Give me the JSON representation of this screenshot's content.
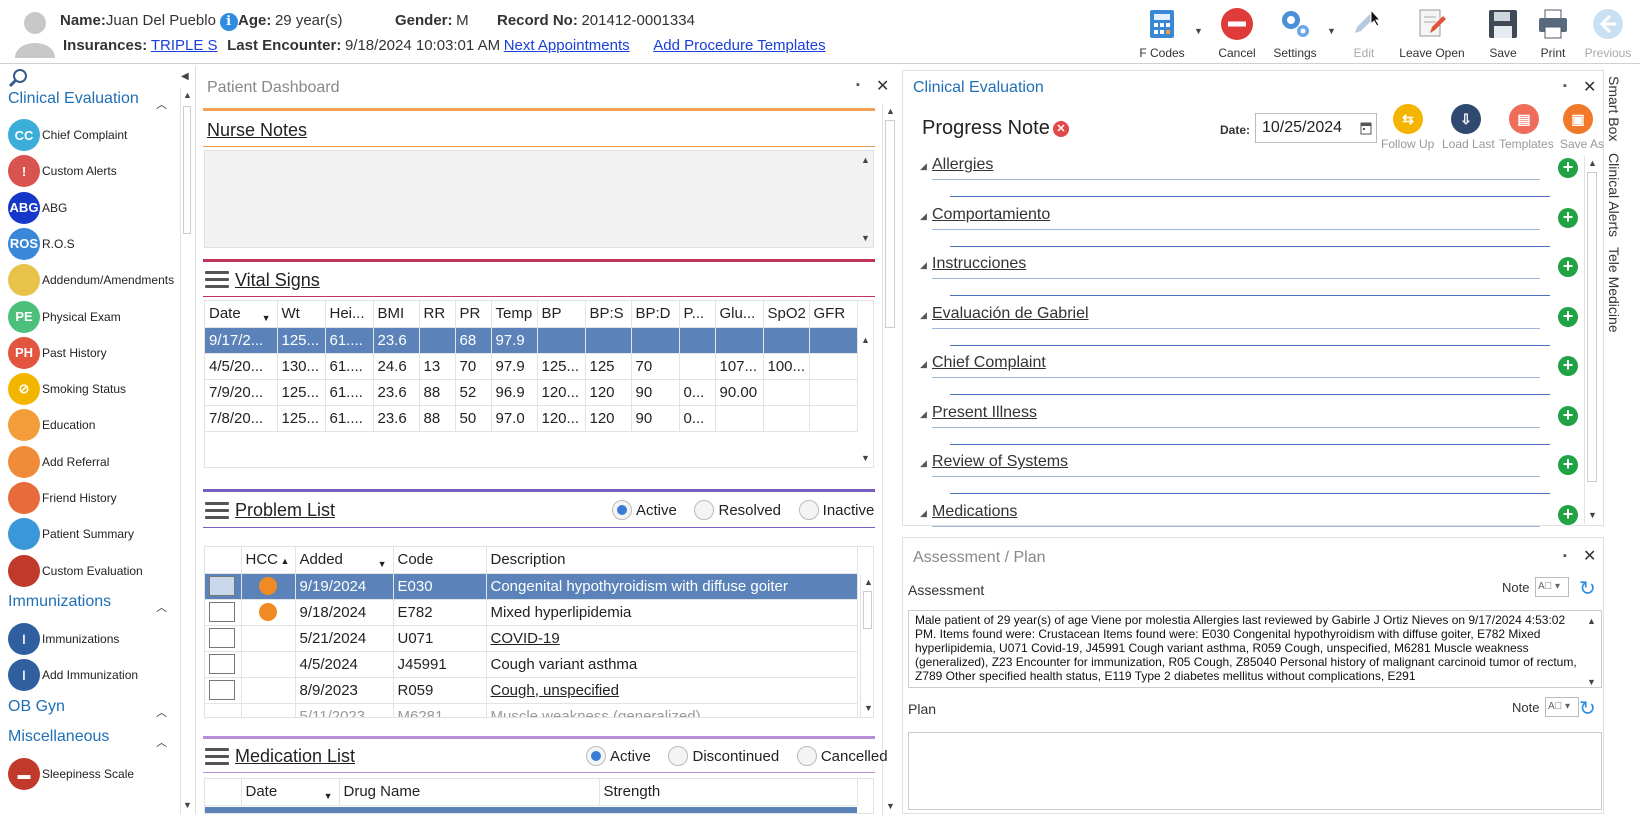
{
  "patient": {
    "name_label": "Name:",
    "name": "Juan Del Pueblo",
    "age_label": "Age:",
    "age": "29 year(s)",
    "gender_label": "Gender:",
    "gender": "M",
    "record_label": "Record No:",
    "record": "201412-0001334",
    "insurances_label": "Insurances:",
    "insurance": "TRIPLE S",
    "last_encounter_label": "Last Encounter:",
    "last_encounter": "9/18/2024 10:03:01 AM",
    "next_appointments": "Next Appointments",
    "add_procedure_templates": "Add Procedure Templates"
  },
  "toolbar": {
    "fcodes": "F Codes",
    "cancel": "Cancel",
    "settings": "Settings",
    "edit": "Edit",
    "leave_open": "Leave Open",
    "save": "Save",
    "print": "Print",
    "previous": "Previous"
  },
  "leftnav": {
    "sections": {
      "clinical": "Clinical Evaluation",
      "immunizations": "Immunizations",
      "obgyn": "OB Gyn",
      "misc": "Miscellaneous"
    },
    "clinical_items": [
      {
        "label": "Chief Complaint",
        "abbr": "CC",
        "color": "#3aaed8"
      },
      {
        "label": "Custom Alerts",
        "abbr": "!",
        "color": "#d9534f"
      },
      {
        "label": "ABG",
        "abbr": "ABG",
        "color": "#1737c9"
      },
      {
        "label": "R.O.S",
        "abbr": "ROS",
        "color": "#3a86d9"
      },
      {
        "label": "Addendum/Amendments",
        "abbr": "",
        "color": "#e9c24a"
      },
      {
        "label": "Physical Exam",
        "abbr": "PE",
        "color": "#4cc07a"
      },
      {
        "label": "Past History",
        "abbr": "PH",
        "color": "#e2553f"
      },
      {
        "label": "Smoking Status",
        "abbr": "⊘",
        "color": "#f2b600"
      },
      {
        "label": "Education",
        "abbr": "",
        "color": "#f39c3a"
      },
      {
        "label": "Add Referral",
        "abbr": "",
        "color": "#f08b3a"
      },
      {
        "label": "Friend History",
        "abbr": "",
        "color": "#e56b3a"
      },
      {
        "label": "Patient Summary",
        "abbr": "",
        "color": "#3a97d9"
      },
      {
        "label": "Custom Evaluation",
        "abbr": "",
        "color": "#c0392b"
      }
    ],
    "immunization_items": [
      {
        "label": "Immunizations",
        "color": "#2f5f9e"
      },
      {
        "label": "Add Immunization",
        "color": "#2f5f9e"
      }
    ],
    "misc_items": [
      {
        "label": "Sleepiness Scale",
        "color": "#c0392b"
      }
    ]
  },
  "dashboard": {
    "title": "Patient Dashboard",
    "nurse_notes": "Nurse Notes",
    "vital_signs": "Vital Signs",
    "vitals_headers": [
      "Date",
      "Wt",
      "Hei...",
      "BMI",
      "RR",
      "PR",
      "Temp",
      "BP",
      "BP:S",
      "BP:D",
      "P...",
      "Glu...",
      "SpO2",
      "GFR"
    ],
    "vitals_rows": [
      [
        "9/17/2...",
        "125...",
        "61....",
        "23.6",
        "",
        "68",
        "97.9",
        "",
        "",
        "",
        "",
        "",
        "",
        ""
      ],
      [
        "4/5/20...",
        "130...",
        "61....",
        "24.6",
        "13",
        "70",
        "97.9",
        "125...",
        "125",
        "70",
        "",
        "107...",
        "100...",
        ""
      ],
      [
        "7/9/20...",
        "125...",
        "61....",
        "23.6",
        "88",
        "52",
        "96.9",
        "120...",
        "120",
        "90",
        "0...",
        "90.00",
        "",
        ""
      ],
      [
        "7/8/20...",
        "125...",
        "61....",
        "23.6",
        "88",
        "50",
        "97.0",
        "120...",
        "120",
        "90",
        "0...",
        "",
        "",
        ""
      ]
    ],
    "problem_list": "Problem List",
    "problem_filters": [
      "Active",
      "Resolved",
      "Inactive"
    ],
    "problem_headers": [
      "",
      "HCC",
      "Added",
      "Code",
      "Description"
    ],
    "problem_rows": [
      {
        "hcc": true,
        "added": "9/19/2024",
        "code": "E030",
        "desc": "Congenital hypothyroidism with diffuse goiter",
        "link": false
      },
      {
        "hcc": true,
        "added": "9/18/2024",
        "code": "E782",
        "desc": "Mixed hyperlipidemia",
        "link": false
      },
      {
        "hcc": false,
        "added": "5/21/2024",
        "code": "U071",
        "desc": "COVID-19",
        "link": true
      },
      {
        "hcc": false,
        "added": "4/5/2024",
        "code": "J45991",
        "desc": "Cough variant asthma",
        "link": false
      },
      {
        "hcc": false,
        "added": "8/9/2023",
        "code": "R059",
        "desc": "Cough, unspecified",
        "link": true
      }
    ],
    "medication_list": "Medication List",
    "medication_filters": [
      "Active",
      "Discontinued",
      "Cancelled"
    ],
    "medication_headers": [
      "",
      "Date",
      "Drug Name",
      "Strength"
    ]
  },
  "clinical": {
    "title": "Clinical Evaluation",
    "progress_note": "Progress Note",
    "date_label": "Date:",
    "date_value": "10/25/2024",
    "actions": [
      "Follow Up",
      "Load Last",
      "Templates",
      "Save As"
    ],
    "sections": [
      "Allergies",
      "Comportamiento",
      "Instrucciones",
      "Evaluación de Gabriel",
      "Chief Complaint",
      "Present Illness",
      "Review of Systems",
      "Medications"
    ]
  },
  "side_tabs": [
    "Smart Box",
    "Clinical Alerts",
    "Tele Medicine"
  ],
  "assessment": {
    "title": "Assessment / Plan",
    "assessment_label": "Assessment",
    "note_label": "Note",
    "assessment_text": "Male patient of 29 year(s) of age Viene por molestia     Allergies last reviewed by Gabirle J Ortiz Nieves on 9/17/2024 4:53:02 PM.    Items found were:  Crustacean  Items found were:  E030 Congenital hypothyroidism with diffuse goiter, E782 Mixed hyperlipidemia, U071 Covid-19, J45991 Cough variant asthma, R059 Cough, unspecified, M6281 Muscle weakness (generalized), Z23 Encounter for immunization, R05 Cough, Z85040 Personal history of malignant carcinoid tumor of rectum, Z789 Other specified health status, E119 Type 2 diabetes mellitus without complications, E291",
    "plan_label": "Plan"
  },
  "colors": {
    "accent": "#1f6fb6",
    "selected_row": "#5b83b9",
    "nurse_bar": "#f0a050",
    "vitals_bar": "#c0345a",
    "problems_bar": "#7b5fc0",
    "meds_bar": "#b58fd8"
  }
}
